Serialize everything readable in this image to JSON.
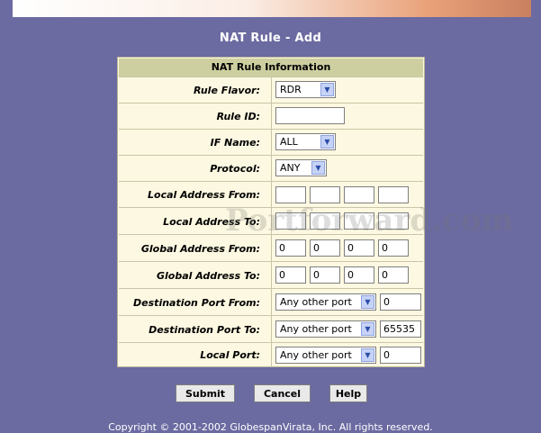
{
  "page": {
    "title": "NAT Rule - Add",
    "copyright": "Copyright © 2001-2002 GlobespanVirata, Inc. All rights reserved."
  },
  "watermark": "Portforward.com",
  "form": {
    "header": "NAT Rule Information",
    "rows": [
      {
        "label": "Rule Flavor:",
        "select": "RDR"
      },
      {
        "label": "Rule ID:",
        "input": ""
      },
      {
        "label": "IF Name:",
        "select": "ALL"
      },
      {
        "label": "Protocol:",
        "select": "ANY"
      },
      {
        "label": "Local Address From:",
        "octets": [
          "",
          "",
          "",
          ""
        ]
      },
      {
        "label": "Local Address To:",
        "octets": [
          "",
          "",
          "",
          ""
        ]
      },
      {
        "label": "Global Address From:",
        "octets": [
          "0",
          "0",
          "0",
          "0"
        ]
      },
      {
        "label": "Global Address To:",
        "octets": [
          "0",
          "0",
          "0",
          "0"
        ]
      },
      {
        "label": "Destination Port From:",
        "select": "Any other port",
        "port": "0"
      },
      {
        "label": "Destination Port To:",
        "select": "Any other port",
        "port": "65535"
      },
      {
        "label": "Local Port:",
        "select": "Any other port",
        "port": "0"
      }
    ]
  },
  "buttons": {
    "submit": "Submit",
    "cancel": "Cancel",
    "help": "Help"
  }
}
